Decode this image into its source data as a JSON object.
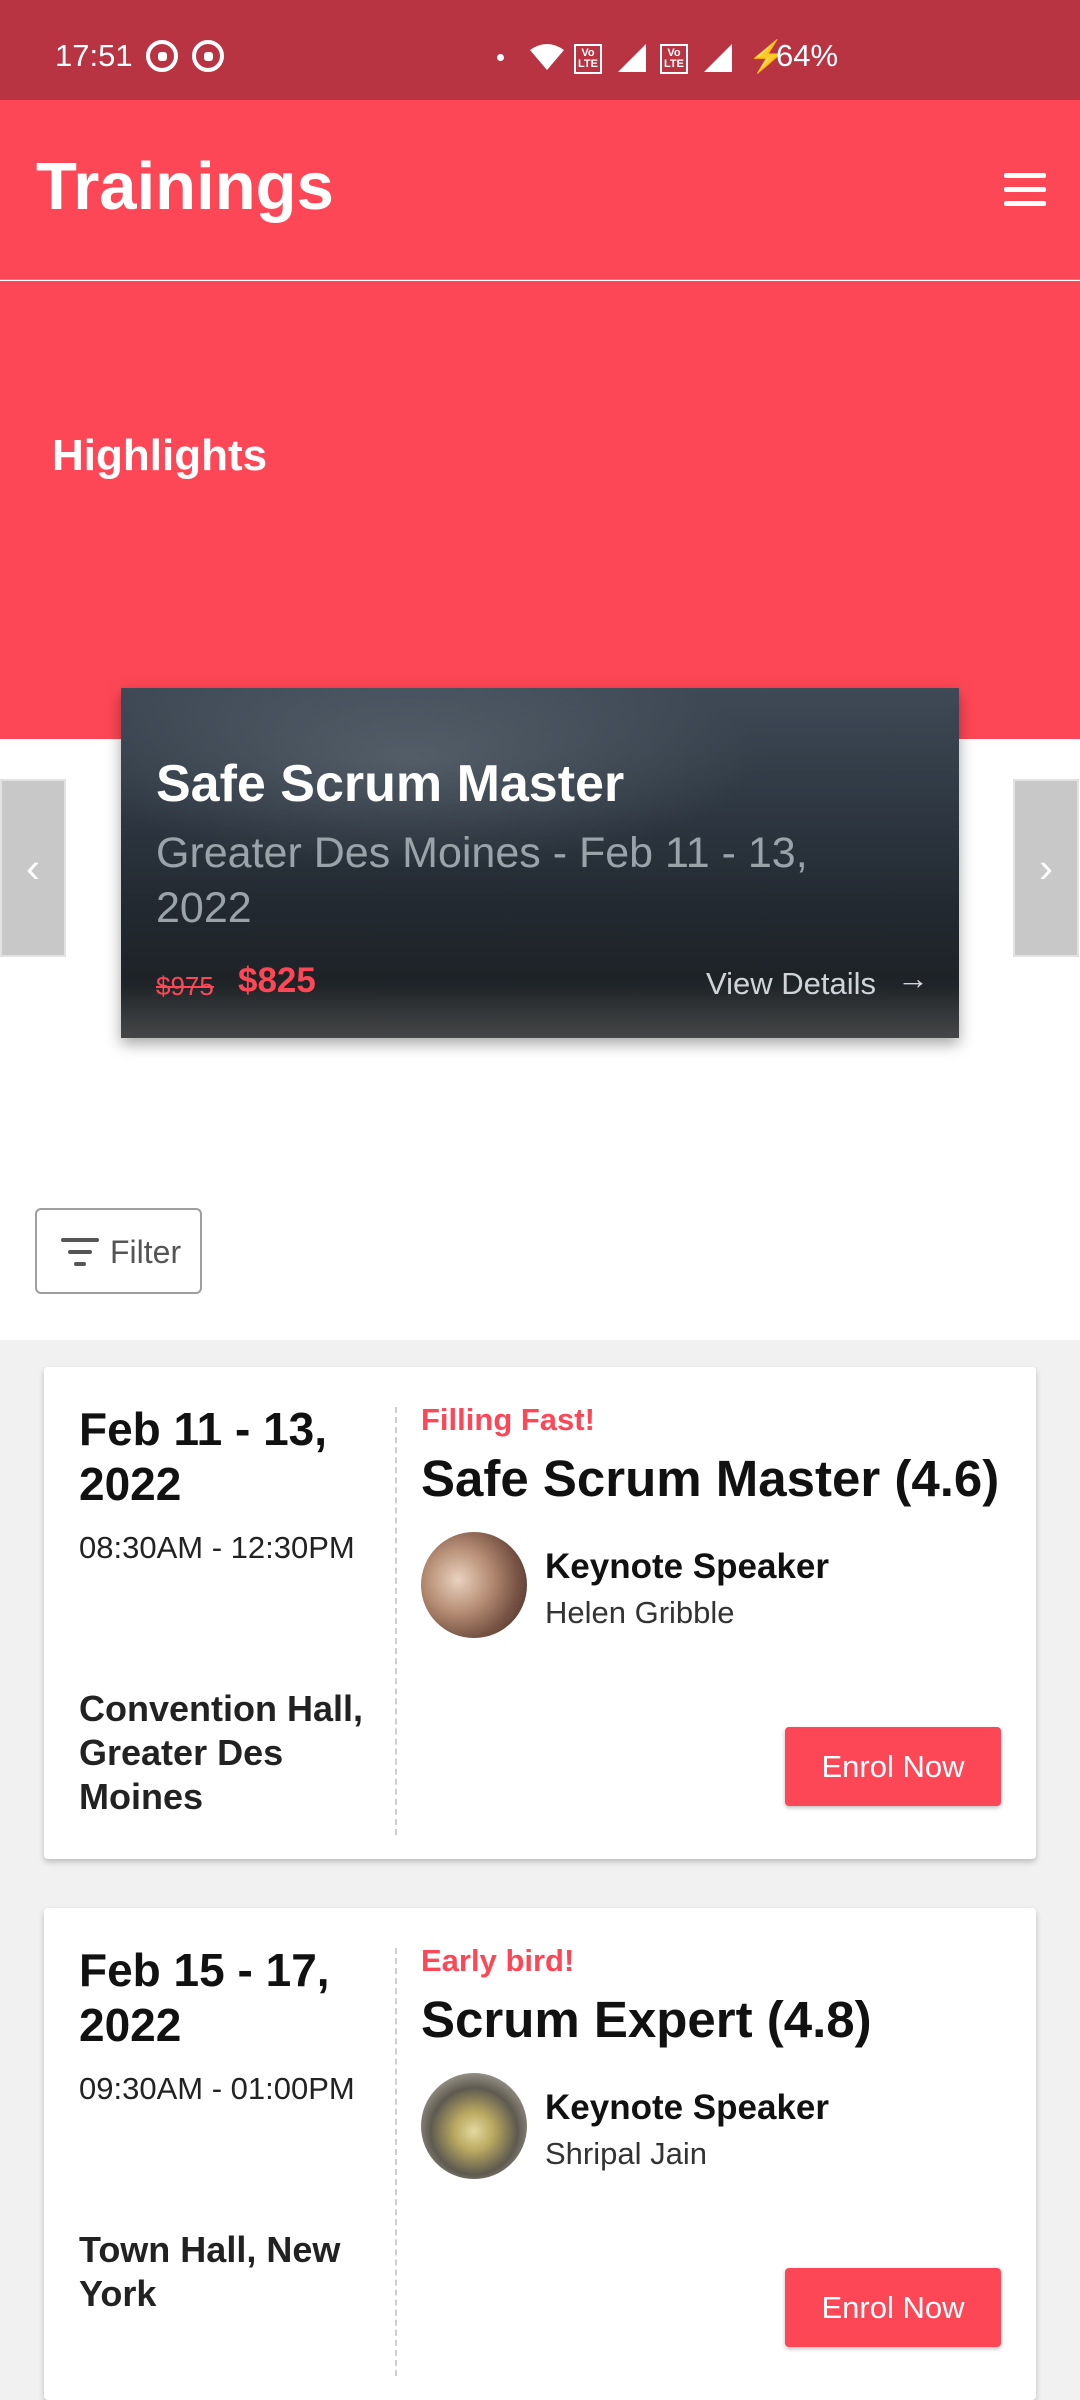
{
  "status_bar": {
    "time": "17:51",
    "volte1": "Vo\nLTE",
    "volte2": "Vo\nLTE",
    "bolt": "⚡",
    "battery": "64%"
  },
  "header": {
    "title": "Trainings",
    "menu_icon": "hamburger-menu-icon"
  },
  "hero": {
    "section_title": "Highlights"
  },
  "highlight": {
    "title": "Safe Scrum Master",
    "subtitle": "Greater Des Moines - Feb 11 - 13, 2022",
    "old_price": "$975",
    "new_price": "$825",
    "link_label": "View Details",
    "link_arrow": "→",
    "prev_icon": "‹",
    "next_icon": "›"
  },
  "filter": {
    "label": "Filter",
    "icon": "filter-icon"
  },
  "events": [
    {
      "date": "Feb 11 - 13, 2022",
      "time": "08:30AM - 12:30PM",
      "venue": "Convention Hall, Greater Des Moines",
      "tag": "Filling Fast!",
      "title": "Safe Scrum Master (4.6)",
      "speaker_role": "Keynote Speaker",
      "speaker_name": "Helen Gribble",
      "button": "Enrol Now"
    },
    {
      "date": "Feb 15 - 17, 2022",
      "time": "09:30AM - 01:00PM",
      "venue": "Town Hall, New York",
      "tag": "Early bird!",
      "title": "Scrum Expert (4.8)",
      "speaker_role": "Keynote Speaker",
      "speaker_name": "Shripal Jain",
      "button": "Enrol Now"
    }
  ],
  "colors": {
    "brand": "#fe4756",
    "status_bar": "#b93442"
  }
}
